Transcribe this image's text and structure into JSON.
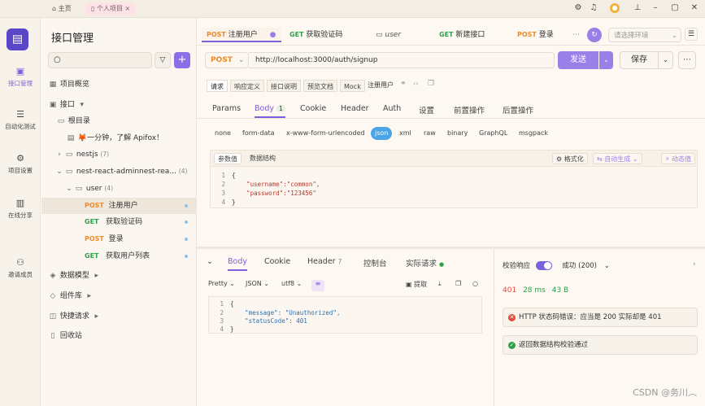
{
  "titlebar": {
    "home_tab": "主页",
    "project_tab": "个人项目",
    "close_glyph": "×"
  },
  "leftbar": {
    "items": [
      {
        "label": "接口管理",
        "icon": "api-icon"
      },
      {
        "label": "自动化测试",
        "icon": "database-icon"
      },
      {
        "label": "项目设置",
        "icon": "settings-icon"
      },
      {
        "label": "在线分享",
        "icon": "share-icon"
      },
      {
        "label": "邀请成员",
        "icon": "add-user-icon"
      }
    ]
  },
  "tree": {
    "title": "接口管理",
    "items": [
      {
        "label": "项目概览"
      },
      {
        "label": "接口"
      },
      {
        "label": "根目录"
      },
      {
        "label": "🦊一分钟，了解 Apifox！"
      },
      {
        "label": "nestjs",
        "count": "(7)"
      },
      {
        "label": "nest-react-adminnest-rea...",
        "count": "(4)"
      },
      {
        "label": "user",
        "count": "(4)"
      },
      {
        "method": "POST",
        "label": "注册用户"
      },
      {
        "method": "GET",
        "label": "获取验证码"
      },
      {
        "method": "POST",
        "label": "登录"
      },
      {
        "method": "GET",
        "label": "获取用户列表"
      },
      {
        "label": "数据模型"
      },
      {
        "label": "组件库"
      },
      {
        "label": "快捷请求"
      },
      {
        "label": "回收站"
      }
    ]
  },
  "tabs": [
    {
      "method": "POST",
      "label": "注册用户"
    },
    {
      "method": "GET",
      "label": "获取验证码"
    },
    {
      "method": "",
      "label": "user"
    },
    {
      "method": "GET",
      "label": "新建接口"
    },
    {
      "method": "POST",
      "label": "登录"
    }
  ],
  "env_select": {
    "placeholder": "请选择环境"
  },
  "request": {
    "method": "POST",
    "url": "http://localhost:3000/auth/signup",
    "send": "发送",
    "save": "保存"
  },
  "subtabs": [
    "请求",
    "响应定义",
    "接口说明",
    "预览文档",
    "Mock"
  ],
  "subtab_name": "注册用户",
  "param_tabs": [
    "Params",
    "Body",
    "Cookie",
    "Header",
    "Auth",
    "设置",
    "前置操作",
    "后置操作"
  ],
  "body_count": "1",
  "body_types": [
    "none",
    "form-data",
    "x-www-form-urlencoded",
    "json",
    "xml",
    "raw",
    "binary",
    "GraphQL",
    "msgpack"
  ],
  "body_tools": {
    "params": "参数值",
    "schema": "数据结构",
    "format": "格式化",
    "autogen": "自动生成",
    "dynamic": "动态值"
  },
  "req_body": {
    "lines": [
      "{",
      "    \"username\":\"common\",",
      "    \"password\":\"123456\"",
      "}"
    ]
  },
  "response": {
    "tabs": [
      "Body",
      "Cookie",
      "Header",
      "控制台",
      "实际请求"
    ],
    "header_count": "7",
    "pretty": "Pretty",
    "json": "JSON",
    "utf8": "utf8",
    "extract": "提取",
    "lines": [
      "{",
      "    \"message\": \"Unauthorized\",",
      "    \"statusCode\": 401",
      "}"
    ]
  },
  "check": {
    "label": "校验响应",
    "result": "成功 (200)",
    "status": "401",
    "time": "28 ms",
    "size": "43 B",
    "error": "HTTP 状态码错误：应当是 200 实际却是 401",
    "ok": "返回数据结构校验通过"
  },
  "watermark": "CSDN @务川︵",
  "colors": {
    "accent": "#7b61d9",
    "post": "#f08a24",
    "get": "#2aa14b",
    "json_pill": "#4aa4e8"
  }
}
